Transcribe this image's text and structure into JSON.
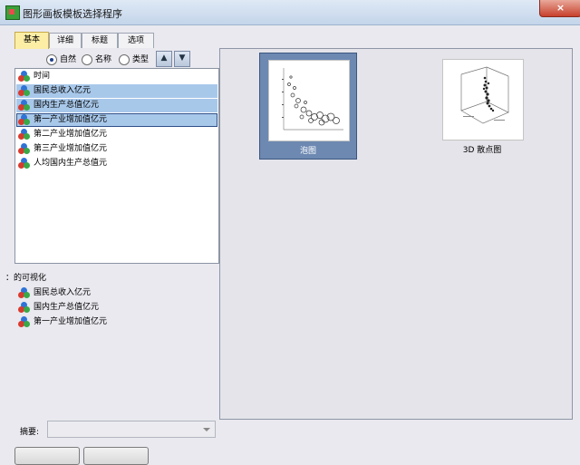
{
  "window": {
    "title": "图形画板模板选择程序",
    "close_label": "×"
  },
  "tabs": [
    {
      "label": "基本",
      "active": true
    },
    {
      "label": "详细",
      "active": false
    },
    {
      "label": "标题",
      "active": false
    },
    {
      "label": "选项",
      "active": false
    }
  ],
  "sort_options": {
    "natural": "自然",
    "name": "名称",
    "type": "类型",
    "selected": "natural"
  },
  "variables": [
    {
      "label": "时间",
      "selected": false
    },
    {
      "label": "国民总收入亿元",
      "selected": true
    },
    {
      "label": "国内生产总值亿元",
      "selected": true
    },
    {
      "label": "第一产业增加值亿元",
      "selected": true,
      "focused": true
    },
    {
      "label": "第二产业增加值亿元",
      "selected": false
    },
    {
      "label": "第三产业增加值亿元",
      "selected": false
    },
    {
      "label": "人均国内生产总值元",
      "selected": false
    }
  ],
  "visualization": {
    "heading": "：的可视化",
    "items": [
      "国民总收入亿元",
      "国内生产总值亿元",
      "第一产业增加值亿元"
    ]
  },
  "summary": {
    "label": "摘要:",
    "value": ""
  },
  "charts": [
    {
      "label": "泡图",
      "selected": true,
      "icon": "bubble-chart-thumbnail"
    },
    {
      "label": "3D 散点图",
      "selected": false,
      "icon": "3d-scatter-thumbnail"
    }
  ],
  "colors": {
    "selection": "#a8c8ea",
    "card_selected": "#6d89b2",
    "active_tab": "#fdeea5"
  }
}
